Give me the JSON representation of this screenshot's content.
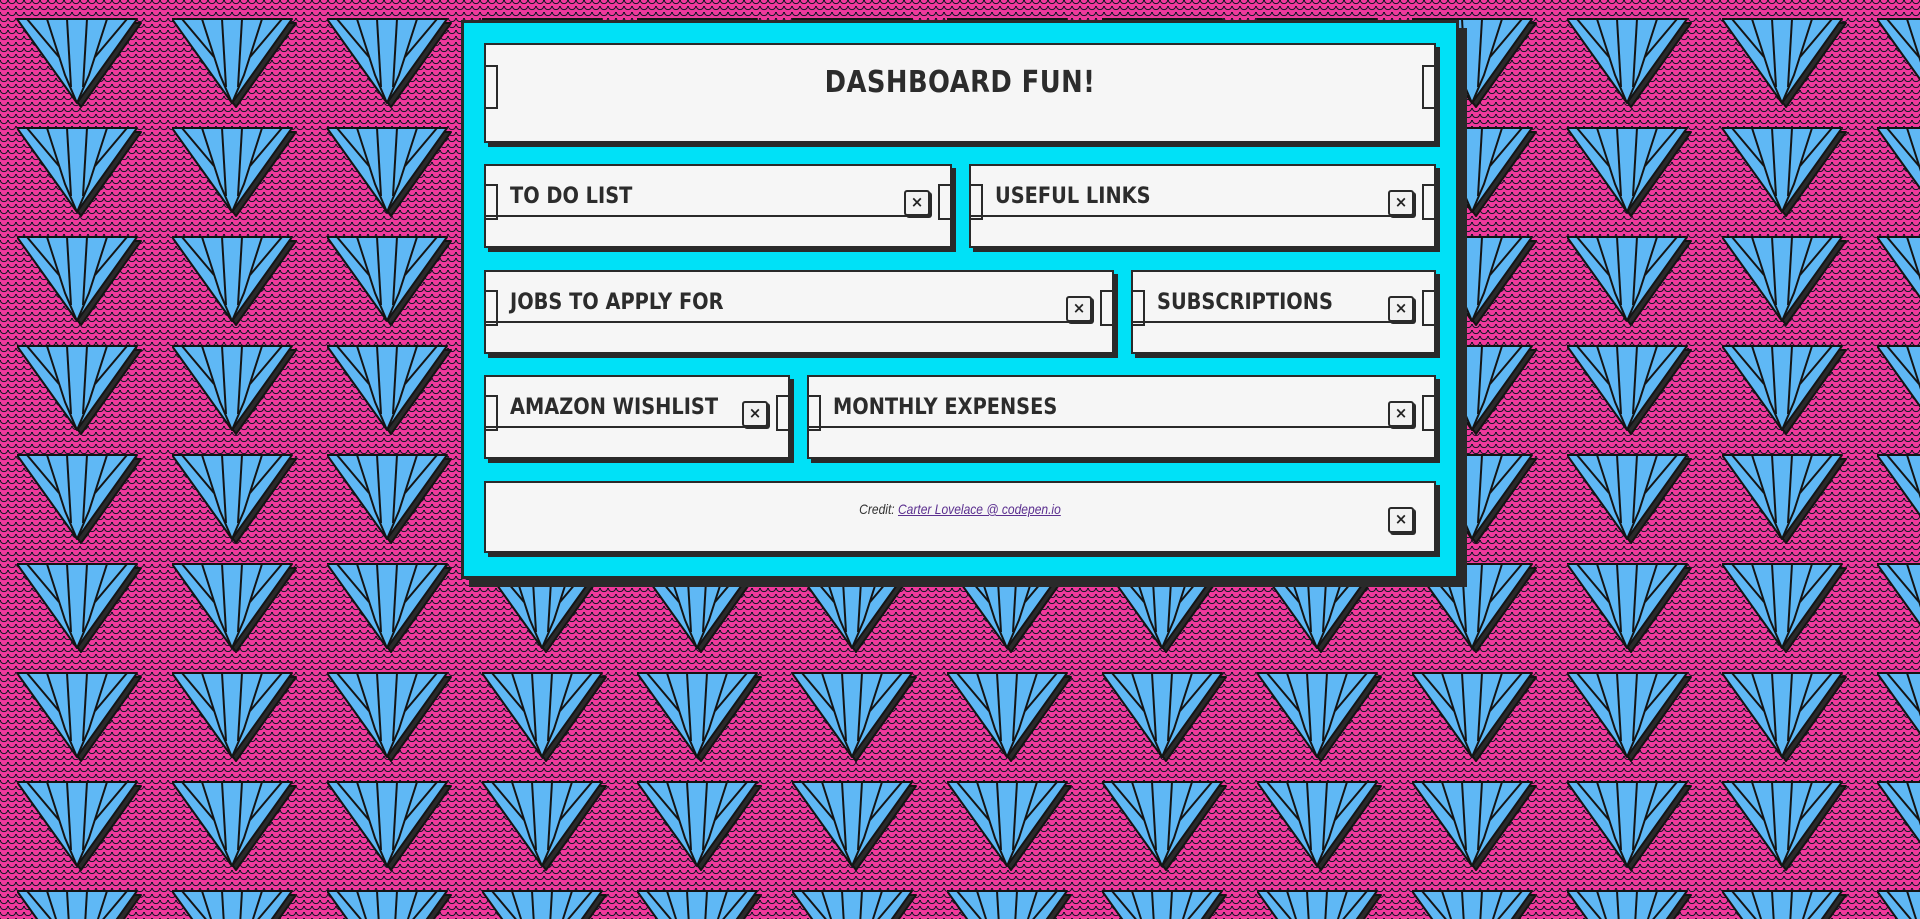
{
  "theme": {
    "background_pink": "#f0399c",
    "dashboard_cyan": "#00e1f7",
    "tile_blue": "#5fb8f5",
    "panel_white": "#f6f6f6",
    "ink": "#2a2a2a"
  },
  "header": {
    "title": "DASHBOARD FUN!"
  },
  "panels": [
    {
      "title": "TO DO LIST",
      "close_icon": "close-icon",
      "close_label": "×"
    },
    {
      "title": "USEFUL LINKS",
      "close_icon": "close-icon",
      "close_label": "×"
    },
    {
      "title": "JOBS TO APPLY FOR",
      "close_icon": "close-icon",
      "close_label": "×"
    },
    {
      "title": "SUBSCRIPTIONS",
      "close_icon": "close-icon",
      "close_label": "×"
    },
    {
      "title": "AMAZON WISHLIST",
      "close_icon": "close-icon",
      "close_label": "×"
    },
    {
      "title": "MONTHLY EXPENSES",
      "close_icon": "close-icon",
      "close_label": "×"
    }
  ],
  "footer": {
    "credit_prefix": "Credit:",
    "credit_link": "Carter Lovelace @ codepen.io",
    "close_label": "×"
  }
}
